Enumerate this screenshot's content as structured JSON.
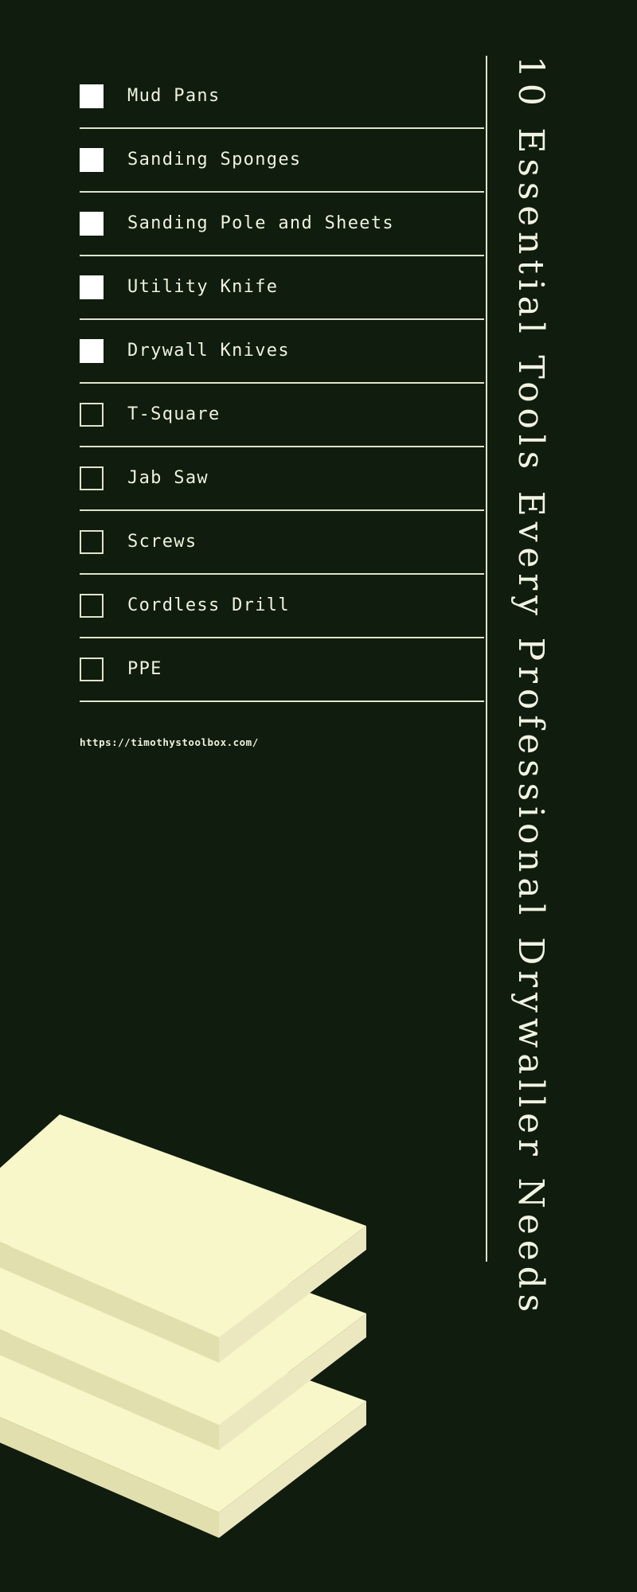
{
  "theme": {
    "background": "#101c0d",
    "ink": "#eef2de",
    "rule": "#dfe4cb",
    "checked_fill": "#ffffff",
    "board_top": "#f7f7c9",
    "board_side_right": "#ebe8c0",
    "board_side_left": "#e2dfae"
  },
  "title": {
    "text": "10 Essential Tools Every Professional Drywaller Needs",
    "orientation": "vertical-right"
  },
  "checklist": {
    "items": [
      {
        "label": "Mud Pans",
        "checked": true
      },
      {
        "label": "Sanding Sponges",
        "checked": true
      },
      {
        "label": "Sanding Pole and Sheets",
        "checked": true
      },
      {
        "label": "Utility Knife",
        "checked": true
      },
      {
        "label": "Drywall Knives",
        "checked": true
      },
      {
        "label": "T-Square",
        "checked": false
      },
      {
        "label": "Jab Saw",
        "checked": false
      },
      {
        "label": "Screws",
        "checked": false
      },
      {
        "label": "Cordless Drill",
        "checked": false
      },
      {
        "label": "PPE",
        "checked": false
      }
    ]
  },
  "footer": {
    "url": "https://timothystoolbox.com/"
  },
  "illustration": {
    "name": "drywall-sheet-stack",
    "sheet_count": 3
  }
}
